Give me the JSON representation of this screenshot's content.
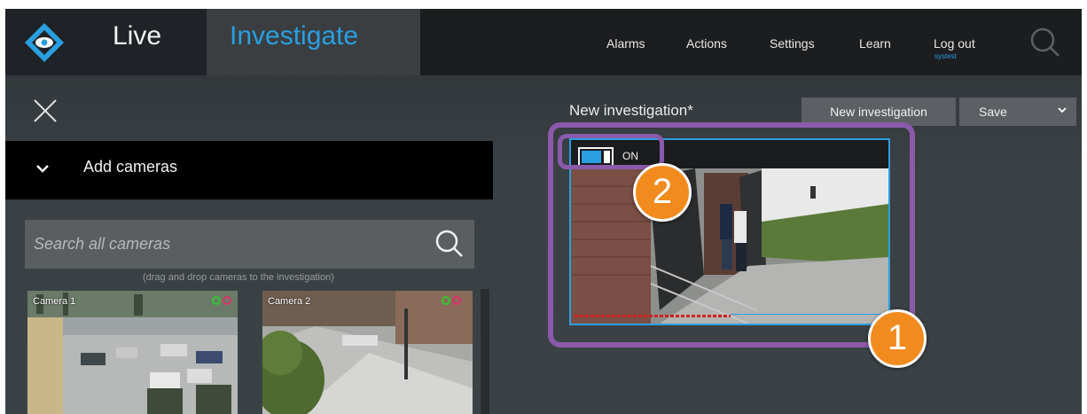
{
  "header": {
    "tabs": [
      {
        "label": "Live",
        "active": false
      },
      {
        "label": "Investigate",
        "active": true
      }
    ],
    "nav": {
      "alarms": "Alarms",
      "actions": "Actions",
      "settings": "Settings",
      "learn": "Learn",
      "logout": "Log out",
      "username": "systest"
    },
    "accent_color": "#2a9fe0"
  },
  "left_panel": {
    "section_title": "Add cameras",
    "search": {
      "placeholder": "Search all cameras",
      "value": ""
    },
    "drag_hint": "(drag and drop cameras to the investigation)",
    "cameras": [
      {
        "name": "Camera 1"
      },
      {
        "name": "Camera 2"
      }
    ]
  },
  "investigation": {
    "title": "New investigation*",
    "new_button": "New investigation",
    "save_button": "Save",
    "tile": {
      "toggle_label": "ON",
      "toggle_on": true
    }
  },
  "callouts": {
    "first": "1",
    "second": "2",
    "color": "#f28b1e",
    "highlight_color": "#8a5aab"
  }
}
